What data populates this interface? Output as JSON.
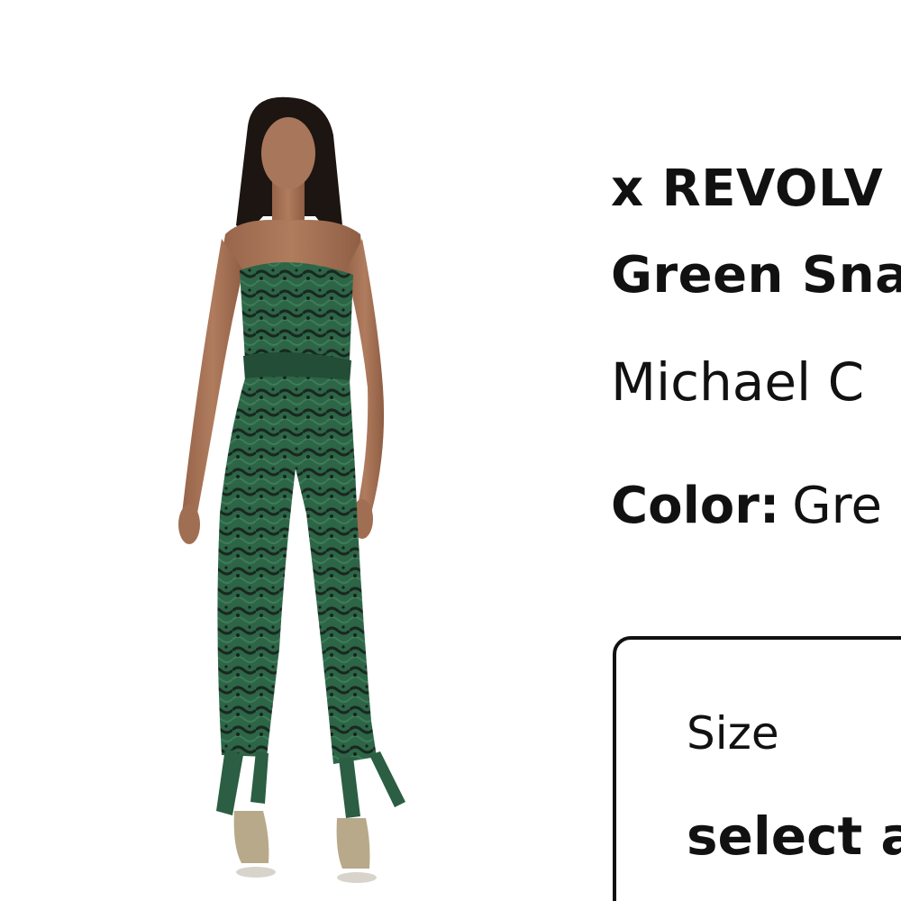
{
  "product": {
    "image_alt": "Model wearing a strapless green snake print jumpsuit",
    "title_line1": "x REVOLV",
    "title_line2": "Green Sna",
    "brand": "Michael C",
    "color_label": "Color:",
    "color_value": "Gre"
  },
  "size_selector": {
    "label": "Size",
    "value": "select a"
  },
  "colors": {
    "garment_green": "#2f6a4a",
    "garment_dark": "#1d2a22",
    "skin": "#a8765a",
    "hair": "#1c1512",
    "text": "#111111"
  }
}
